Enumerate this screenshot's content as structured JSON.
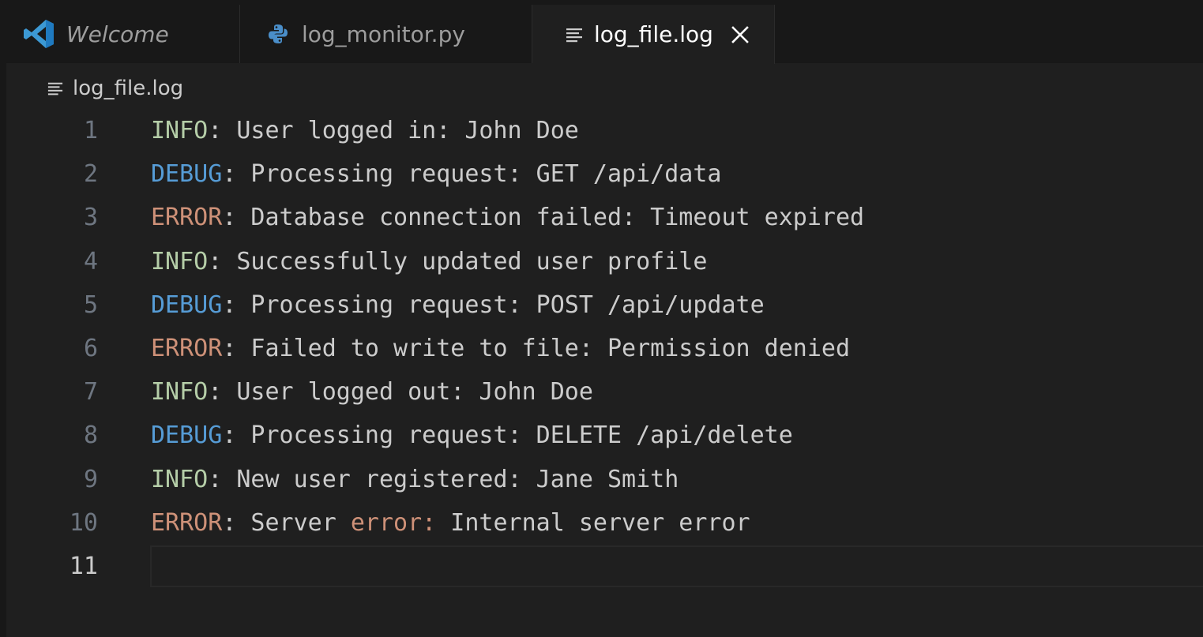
{
  "tabs": [
    {
      "label": "Welcome",
      "icon": "vscode-icon",
      "active": false
    },
    {
      "label": "log_monitor.py",
      "icon": "python-icon",
      "active": false
    },
    {
      "label": "log_file.log",
      "icon": "lines-icon",
      "active": true
    }
  ],
  "breadcrumb": {
    "file": "log_file.log"
  },
  "lines": [
    {
      "number": "1",
      "level": "INFO",
      "text": ": User logged in: John Doe"
    },
    {
      "number": "2",
      "level": "DEBUG",
      "text": ": Processing request: GET /api/data"
    },
    {
      "number": "3",
      "level": "ERROR",
      "text": ": Database connection failed: Timeout expired"
    },
    {
      "number": "4",
      "level": "INFO",
      "text": ": Successfully updated user profile"
    },
    {
      "number": "5",
      "level": "DEBUG",
      "text": ": Processing request: POST /api/update"
    },
    {
      "number": "6",
      "level": "ERROR",
      "text": ": Failed to write to file: Permission denied"
    },
    {
      "number": "7",
      "level": "INFO",
      "text": ": User logged out: John Doe"
    },
    {
      "number": "8",
      "level": "DEBUG",
      "text": ": Processing request: DELETE /api/delete"
    },
    {
      "number": "9",
      "level": "INFO",
      "text": ": New user registered: Jane Smith"
    },
    {
      "number": "10",
      "level": "ERROR",
      "text_before": ": Server ",
      "highlight": "error:",
      "text_after": " Internal server error"
    },
    {
      "number": "11",
      "level": "",
      "text": ""
    }
  ],
  "colors": {
    "info": "#b5cea8",
    "debug": "#569cd6",
    "error": "#ce9178",
    "background": "#1f1f1f",
    "tabbar": "#181818"
  }
}
